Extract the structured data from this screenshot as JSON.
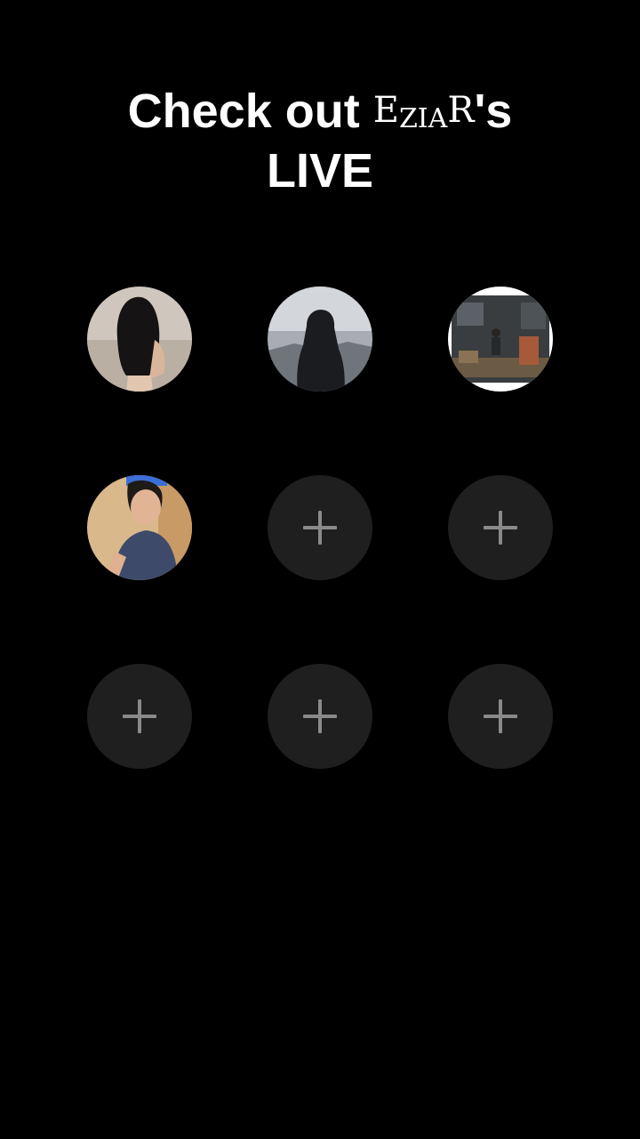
{
  "header": {
    "title_prefix": "Check out",
    "name_first": "E",
    "name_mid": "ZIA",
    "name_last": "R",
    "title_suffix": "'s",
    "title_line2": "LIVE"
  },
  "slots": [
    {
      "type": "avatar",
      "icon": "avatar-woman-long-hair"
    },
    {
      "type": "avatar",
      "icon": "avatar-hooded-figure"
    },
    {
      "type": "avatar",
      "icon": "avatar-room-scene"
    },
    {
      "type": "avatar",
      "icon": "avatar-man-selfie"
    },
    {
      "type": "add",
      "icon": "plus-icon"
    },
    {
      "type": "add",
      "icon": "plus-icon"
    },
    {
      "type": "add",
      "icon": "plus-icon"
    },
    {
      "type": "add",
      "icon": "plus-icon"
    },
    {
      "type": "add",
      "icon": "plus-icon"
    }
  ],
  "colors": {
    "background": "#000000",
    "add_slot": "#1f1f1f",
    "plus": "#8a8a8a",
    "text": "#ffffff"
  }
}
